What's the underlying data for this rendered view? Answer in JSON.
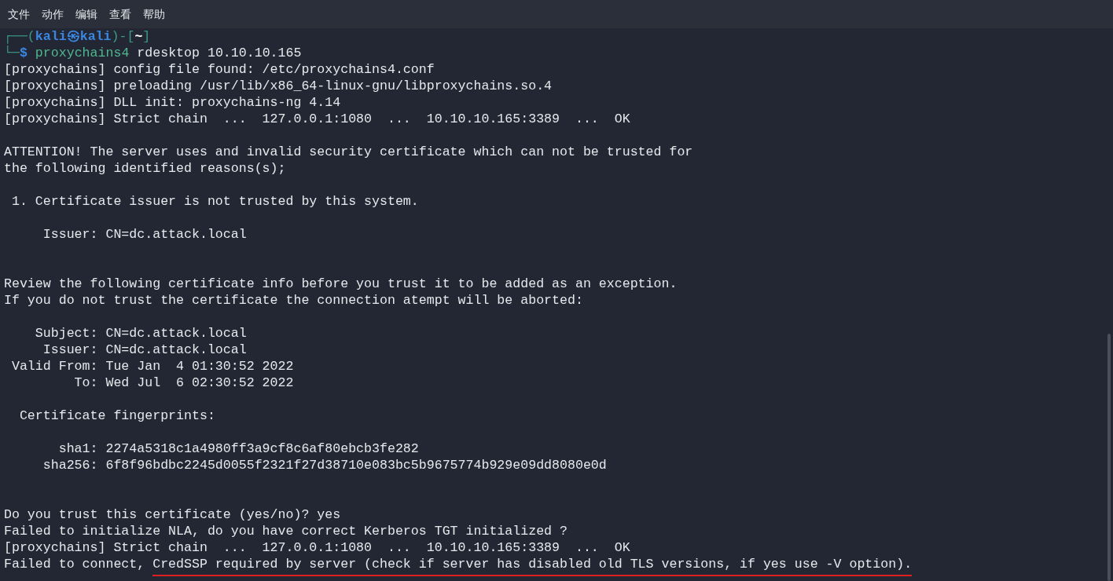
{
  "menu": [
    {
      "label": "文件"
    },
    {
      "label": "动作"
    },
    {
      "label": "编辑"
    },
    {
      "label": "查看"
    },
    {
      "label": "帮助"
    }
  ],
  "lines": [
    {
      "kind": "prompt",
      "segments": [
        {
          "text": "┌──(",
          "kind": "frame"
        },
        {
          "text": "kali㉿kali",
          "kind": "user"
        },
        {
          "text": ")-[",
          "kind": "frame"
        },
        {
          "text": "~",
          "kind": "cwd"
        },
        {
          "text": "]",
          "kind": "frame"
        }
      ]
    },
    {
      "kind": "prompt",
      "segments": [
        {
          "text": "└─",
          "kind": "frame"
        },
        {
          "text": "$",
          "kind": "user"
        },
        {
          "text": " proxychains4",
          "kind": "command"
        },
        {
          "text": " rdesktop 10.10.10.165",
          "kind": "plain"
        }
      ]
    },
    {
      "kind": "output",
      "text": "[proxychains] config file found: /etc/proxychains4.conf"
    },
    {
      "kind": "output",
      "text": "[proxychains] preloading /usr/lib/x86_64-linux-gnu/libproxychains.so.4"
    },
    {
      "kind": "output",
      "text": "[proxychains] DLL init: proxychains-ng 4.14"
    },
    {
      "kind": "output",
      "text": "[proxychains] Strict chain  ...  127.0.0.1:1080  ...  10.10.10.165:3389  ...  OK"
    },
    {
      "kind": "blank"
    },
    {
      "kind": "output",
      "text": "ATTENTION! The server uses and invalid security certificate which can not be trusted for"
    },
    {
      "kind": "output",
      "text": "the following identified reasons(s);"
    },
    {
      "kind": "blank"
    },
    {
      "kind": "output",
      "text": " 1. Certificate issuer is not trusted by this system."
    },
    {
      "kind": "blank"
    },
    {
      "kind": "output",
      "text": "     Issuer: CN=dc.attack.local"
    },
    {
      "kind": "blank"
    },
    {
      "kind": "blank"
    },
    {
      "kind": "output",
      "text": "Review the following certificate info before you trust it to be added as an exception."
    },
    {
      "kind": "output",
      "text": "If you do not trust the certificate the connection atempt will be aborted:"
    },
    {
      "kind": "blank"
    },
    {
      "kind": "output",
      "text": "    Subject: CN=dc.attack.local"
    },
    {
      "kind": "output",
      "text": "     Issuer: CN=dc.attack.local"
    },
    {
      "kind": "output",
      "text": " Valid From: Tue Jan  4 01:30:52 2022"
    },
    {
      "kind": "output",
      "text": "         To: Wed Jul  6 02:30:52 2022"
    },
    {
      "kind": "blank"
    },
    {
      "kind": "output",
      "text": "  Certificate fingerprints:"
    },
    {
      "kind": "blank"
    },
    {
      "kind": "output",
      "text": "       sha1: 2274a5318c1a4980ff3a9cf8c6af80ebcb3fe282"
    },
    {
      "kind": "output",
      "text": "     sha256: 6f8f96bdbc2245d0055f2321f27d38710e083bc5b9675774b929e09dd8080e0d"
    },
    {
      "kind": "blank"
    },
    {
      "kind": "blank"
    },
    {
      "kind": "output",
      "text": "Do you trust this certificate (yes/no)? yes"
    },
    {
      "kind": "output",
      "text": "Failed to initialize NLA, do you have correct Kerberos TGT initialized ?"
    },
    {
      "kind": "output",
      "text": "[proxychains] Strict chain  ...  127.0.0.1:1080  ...  10.10.10.165:3389  ...  OK"
    },
    {
      "kind": "annotated",
      "segments": [
        {
          "text": "Failed to connect, ",
          "underlined": false
        },
        {
          "text": "CredSSP required by server (check if server has disabled old TLS versions, if yes use -V option).",
          "underlined": true
        }
      ]
    }
  ]
}
